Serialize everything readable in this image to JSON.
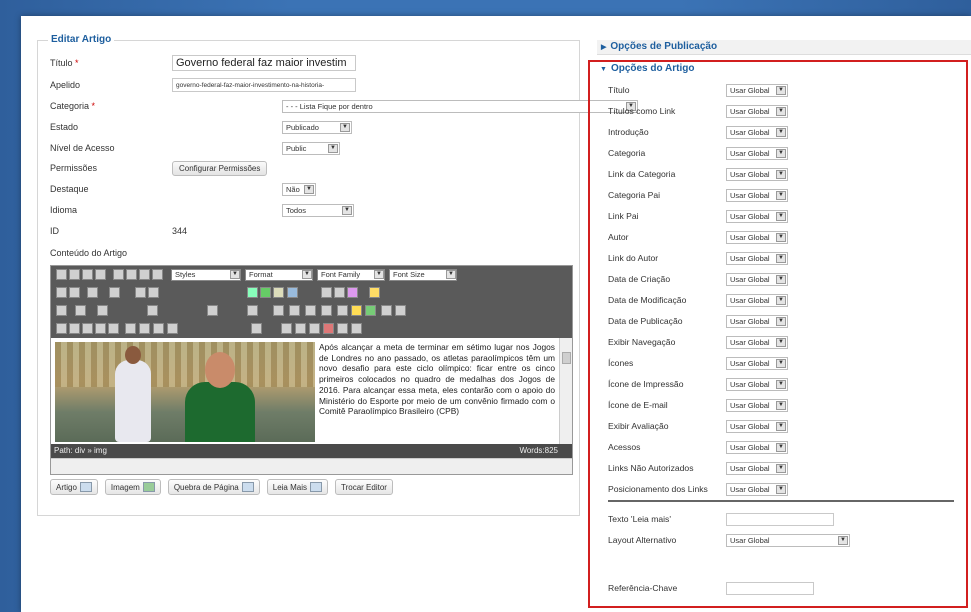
{
  "form": {
    "legend": "Editar Artigo",
    "titulo": {
      "label": "Título",
      "required": "*",
      "value": "Governo federal faz maior investim"
    },
    "apelido": {
      "label": "Apelido",
      "value": "governo-federal-faz-maior-investimento-na-historia-"
    },
    "categoria": {
      "label": "Categoria",
      "required": "*",
      "value": "- - - Lista Fique por dentro"
    },
    "estado": {
      "label": "Estado",
      "value": "Publicado"
    },
    "nivel": {
      "label": "Nível de Acesso",
      "value": "Public"
    },
    "permissoes": {
      "label": "Permissões",
      "button": "Configurar Permissões"
    },
    "destaque": {
      "label": "Destaque",
      "value": "Não"
    },
    "idioma": {
      "label": "Idioma",
      "value": "Todos"
    },
    "id": {
      "label": "ID",
      "value": "344"
    },
    "conteudo_label": "Conteúdo do Artigo"
  },
  "editor": {
    "styles": "Styles",
    "format": "Format",
    "font_family": "Font Family",
    "font_size": "Font Size",
    "body": "Após alcançar a meta de terminar em sétimo lugar nos Jogos de Londres no ano passado, os atletas paraolímpicos têm um novo desafio para este ciclo olímpico: ficar entre os cinco primeiros colocados no quadro de medalhas dos Jogos de 2016. Para alcançar essa meta, eles contarão com o apoio do Ministério do Esporte por meio de um convênio firmado com o Comitê Paraolímpico Brasileiro (CPB)",
    "path": "Path: div » img",
    "words": "Words:825",
    "buttons": [
      "Artigo",
      "Imagem",
      "Quebra de Página",
      "Leia Mais",
      "Trocar Editor"
    ]
  },
  "panels": {
    "publicacao": "Opções de Publicação",
    "artigo": "Opções do Artigo"
  },
  "article_options": [
    {
      "label": "Título",
      "value": "Usar Global"
    },
    {
      "label": "Títulos como Link",
      "value": "Usar Global"
    },
    {
      "label": "Introdução",
      "value": "Usar Global"
    },
    {
      "label": "Categoria",
      "value": "Usar Global"
    },
    {
      "label": "Link da Categoria",
      "value": "Usar Global"
    },
    {
      "label": "Categoria Pai",
      "value": "Usar Global"
    },
    {
      "label": "Link Pai",
      "value": "Usar Global"
    },
    {
      "label": "Autor",
      "value": "Usar Global"
    },
    {
      "label": "Link do Autor",
      "value": "Usar Global"
    },
    {
      "label": "Data de Criação",
      "value": "Usar Global"
    },
    {
      "label": "Data de Modificação",
      "value": "Usar Global"
    },
    {
      "label": "Data de Publicação",
      "value": "Usar Global"
    },
    {
      "label": "Exibir Navegação",
      "value": "Usar Global"
    },
    {
      "label": "Ícones",
      "value": "Usar Global"
    },
    {
      "label": "Ícone de Impressão",
      "value": "Usar Global"
    },
    {
      "label": "Ícone de E-mail",
      "value": "Usar Global"
    },
    {
      "label": "Exibir Avaliação",
      "value": "Usar Global"
    },
    {
      "label": "Acessos",
      "value": "Usar Global"
    },
    {
      "label": "Links Não Autorizados",
      "value": "Usar Global"
    },
    {
      "label": "Posicionamento dos Links",
      "value": "Usar Global"
    }
  ],
  "extra_options": {
    "leia_mais": {
      "label": "Texto 'Leia mais'",
      "value": ""
    },
    "layout": {
      "label": "Layout Alternativo",
      "value": "Usar Global"
    },
    "referencia": {
      "label": "Referência-Chave",
      "value": ""
    }
  }
}
